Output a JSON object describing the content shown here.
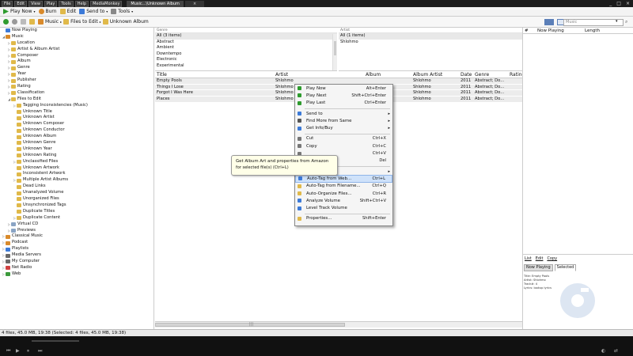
{
  "titlebar": {
    "menus": [
      "File",
      "Edit",
      "View",
      "Play",
      "Tools",
      "Help",
      "MediaMonkey"
    ],
    "tab_label": "Music...\\Unknown Album",
    "tab_close": "×",
    "window_buttons": [
      "_",
      "□",
      "×"
    ]
  },
  "toolbar1": {
    "play_now": "Play Now",
    "burn": "Burn",
    "edit": "Edit",
    "send_to": "Send to",
    "tools": "Tools"
  },
  "toolbar2": {
    "crumbs": [
      "Music",
      "Files to Edit",
      "Unknown Album"
    ],
    "search_placeholder": "Music"
  },
  "sidebar": {
    "items": [
      {
        "label": "Now Playing",
        "indent": 0,
        "expander": "",
        "color": "#3c7ad8"
      },
      {
        "label": "Music",
        "indent": 0,
        "expander": "◢",
        "color": "#d98a2b"
      },
      {
        "label": "Location",
        "indent": 1,
        "expander": "▷",
        "color": "#e0b94a"
      },
      {
        "label": "Artist & Album Artist",
        "indent": 1,
        "expander": "▷",
        "color": "#e0b94a"
      },
      {
        "label": "Composer",
        "indent": 1,
        "expander": "▷",
        "color": "#e0b94a"
      },
      {
        "label": "Album",
        "indent": 1,
        "expander": "▷",
        "color": "#e0b94a"
      },
      {
        "label": "Genre",
        "indent": 1,
        "expander": "▷",
        "color": "#e0b94a"
      },
      {
        "label": "Year",
        "indent": 1,
        "expander": "▷",
        "color": "#e0b94a"
      },
      {
        "label": "Publisher",
        "indent": 1,
        "expander": "▷",
        "color": "#e0b94a"
      },
      {
        "label": "Rating",
        "indent": 1,
        "expander": "▷",
        "color": "#e0b94a"
      },
      {
        "label": "Classification",
        "indent": 1,
        "expander": "▷",
        "color": "#e0b94a"
      },
      {
        "label": "Files to Edit",
        "indent": 1,
        "expander": "◢",
        "color": "#e0b94a"
      },
      {
        "label": "Tagging Inconsistencies (Music)",
        "indent": 2,
        "expander": "▷",
        "color": "#e0b94a"
      },
      {
        "label": "Unknown Title",
        "indent": 2,
        "expander": "",
        "color": "#e0b94a"
      },
      {
        "label": "Unknown Artist",
        "indent": 2,
        "expander": "",
        "color": "#e0b94a"
      },
      {
        "label": "Unknown Composer",
        "indent": 2,
        "expander": "",
        "color": "#e0b94a"
      },
      {
        "label": "Unknown Conductor",
        "indent": 2,
        "expander": "",
        "color": "#e0b94a"
      },
      {
        "label": "Unknown Album",
        "indent": 2,
        "expander": "",
        "color": "#e0b94a"
      },
      {
        "label": "Unknown Genre",
        "indent": 2,
        "expander": "",
        "color": "#e0b94a"
      },
      {
        "label": "Unknown Year",
        "indent": 2,
        "expander": "",
        "color": "#e0b94a"
      },
      {
        "label": "Unknown Rating",
        "indent": 2,
        "expander": "",
        "color": "#e0b94a"
      },
      {
        "label": "Unclassified Files",
        "indent": 2,
        "expander": "▷",
        "color": "#e0b94a"
      },
      {
        "label": "Unknown Artwork",
        "indent": 2,
        "expander": "",
        "color": "#e0b94a"
      },
      {
        "label": "Inconsistent Artwork",
        "indent": 2,
        "expander": "",
        "color": "#e0b94a"
      },
      {
        "label": "Multiple Artist Albums",
        "indent": 2,
        "expander": "▷",
        "color": "#e0b94a"
      },
      {
        "label": "Dead Links",
        "indent": 2,
        "expander": "",
        "color": "#e0b94a"
      },
      {
        "label": "Unanalyzed Volume",
        "indent": 2,
        "expander": "",
        "color": "#e0b94a"
      },
      {
        "label": "Unorganized Files",
        "indent": 2,
        "expander": "",
        "color": "#e0b94a"
      },
      {
        "label": "Unsynchronized Tags",
        "indent": 2,
        "expander": "",
        "color": "#e0b94a"
      },
      {
        "label": "Duplicate Titles",
        "indent": 2,
        "expander": "",
        "color": "#e0b94a"
      },
      {
        "label": "Duplicate Content",
        "indent": 2,
        "expander": "▷",
        "color": "#e0b94a"
      },
      {
        "label": "Virtual CD",
        "indent": 1,
        "expander": "▷",
        "color": "#8aa4c4"
      },
      {
        "label": "Previews",
        "indent": 1,
        "expander": "▷",
        "color": "#8aa4c4"
      },
      {
        "label": "Classical Music",
        "indent": 0,
        "expander": "▷",
        "color": "#d98a2b"
      },
      {
        "label": "Podcast",
        "indent": 0,
        "expander": "▷",
        "color": "#d98a2b"
      },
      {
        "label": "Playlists",
        "indent": 0,
        "expander": "▷",
        "color": "#3c7ad8"
      },
      {
        "label": "Media Servers",
        "indent": 0,
        "expander": "▷",
        "color": "#6a6a6a"
      },
      {
        "label": "My Computer",
        "indent": 0,
        "expander": "▷",
        "color": "#6a6a6a"
      },
      {
        "label": "Net Radio",
        "indent": 0,
        "expander": "▷",
        "color": "#d04040"
      },
      {
        "label": "Web",
        "indent": 0,
        "expander": "▷",
        "color": "#3c9a3c"
      }
    ]
  },
  "genre_pane": {
    "header": "Genre",
    "items": [
      "All (3 items)",
      "Abstract",
      "Ambient",
      "Downtempo",
      "Electronic",
      "Experimental"
    ]
  },
  "artist_pane": {
    "header": "Artist",
    "items": [
      "All (1 items)",
      "Shlohmo"
    ]
  },
  "tracklist": {
    "columns": {
      "title": "Title",
      "artist": "Artist",
      "album": "Album",
      "album_artist": "Album Artist",
      "date": "Date",
      "genre": "Genre",
      "rating": "Rating"
    },
    "rows": [
      {
        "title": "Empty Pools",
        "artist": "Shlohmo",
        "album": "",
        "album_artist": "Shlohmo",
        "date": "2011",
        "genre": "Abstract; Do..."
      },
      {
        "title": "Things I Lose",
        "artist": "Shlohmo",
        "album": "",
        "album_artist": "Shlohmo",
        "date": "2011",
        "genre": "Abstract; Do..."
      },
      {
        "title": "Forgot I Was Here",
        "artist": "Shlohmo",
        "album": "",
        "album_artist": "Shlohmo",
        "date": "2011",
        "genre": "Abstract; Do..."
      },
      {
        "title": "Places",
        "artist": "Shlohmo",
        "album": "",
        "album_artist": "Shlohmo",
        "date": "2011",
        "genre": "Abstract; Do..."
      }
    ],
    "scroll_indicator": "|||"
  },
  "right_pane": {
    "col_hash": "#",
    "col_now_playing": "Now Playing",
    "col_length": "Length",
    "menu": [
      "List",
      "Edit",
      "Copy"
    ],
    "tabs": [
      "Now Playing",
      "Selected"
    ],
    "info_lines": [
      "Title: Empty Pools",
      "Artist: Shlohmo",
      "Track#: 4",
      "Lyrics: lookup lyrics"
    ]
  },
  "context_menu": {
    "items": [
      {
        "type": "item",
        "label": "Play Now",
        "shortcut": "Alt+Enter",
        "icon": "play-icon",
        "color": "#2e9b2e"
      },
      {
        "type": "item",
        "label": "Play Next",
        "shortcut": "Shift+Ctrl+Enter",
        "icon": "play-next-icon",
        "color": "#2e9b2e"
      },
      {
        "type": "item",
        "label": "Play Last",
        "shortcut": "Ctrl+Enter",
        "icon": "play-last-icon",
        "color": "#2e9b2e"
      },
      {
        "type": "sep"
      },
      {
        "type": "item",
        "label": "Send to",
        "shortcut": "",
        "icon": "send-to-icon",
        "color": "#3c7ad8",
        "submenu": true
      },
      {
        "type": "item",
        "label": "Find More from Same",
        "shortcut": "",
        "icon": "find-icon",
        "color": "#555555",
        "submenu": true
      },
      {
        "type": "item",
        "label": "Get Info/Buy",
        "shortcut": "",
        "icon": "info-icon",
        "color": "#3c7ad8",
        "submenu": true
      },
      {
        "type": "sep"
      },
      {
        "type": "item",
        "label": "Cut",
        "shortcut": "Ctrl+X",
        "icon": "cut-icon",
        "color": "#777777"
      },
      {
        "type": "item",
        "label": "Copy",
        "shortcut": "Ctrl+C",
        "icon": "copy-icon",
        "color": "#777777"
      },
      {
        "type": "item",
        "label": "",
        "shortcut": "Ctrl+V",
        "icon": "paste-icon",
        "color": "#777777"
      },
      {
        "type": "item",
        "label": "",
        "shortcut": "Del",
        "icon": "delete-icon",
        "color": "#d04040"
      },
      {
        "type": "sep"
      },
      {
        "type": "item",
        "label": "",
        "shortcut": "",
        "icon": "",
        "color": "#777777",
        "submenu": true
      },
      {
        "type": "item",
        "label": "Auto-Tag from Web...",
        "shortcut": "Ctrl+L",
        "icon": "auto-tag-web-icon",
        "color": "#3c7ad8",
        "highlight": true
      },
      {
        "type": "item",
        "label": "Auto-Tag from Filename...",
        "shortcut": "Ctrl+Q",
        "icon": "auto-tag-filename-icon",
        "color": "#e0b94a"
      },
      {
        "type": "item",
        "label": "Auto-Organize Files...",
        "shortcut": "Ctrl+R",
        "icon": "auto-organize-icon",
        "color": "#e0b94a"
      },
      {
        "type": "item",
        "label": "Analyze Volume",
        "shortcut": "Shift+Ctrl+V",
        "icon": "analyze-volume-icon",
        "color": "#3c7ad8"
      },
      {
        "type": "item",
        "label": "Level Track Volume",
        "shortcut": "",
        "icon": "level-volume-icon",
        "color": "#3c7ad8"
      },
      {
        "type": "sep"
      },
      {
        "type": "item",
        "label": "Properties...",
        "shortcut": "Shift+Enter",
        "icon": "properties-icon",
        "color": "#e0b94a"
      }
    ]
  },
  "tooltip": {
    "line1": "Get Album Art and properties from Amazon",
    "line2": "for selected file(s) (Ctrl+L)"
  },
  "statusbar": {
    "text": "4 files, 45.0 MB, 19:38 (Selected: 4 files, 45.0 MB, 19:38)"
  },
  "player": {
    "controls": [
      "⏮",
      "▶",
      "⏸",
      "⏭"
    ],
    "extra": [
      "◐",
      "⇄"
    ]
  }
}
